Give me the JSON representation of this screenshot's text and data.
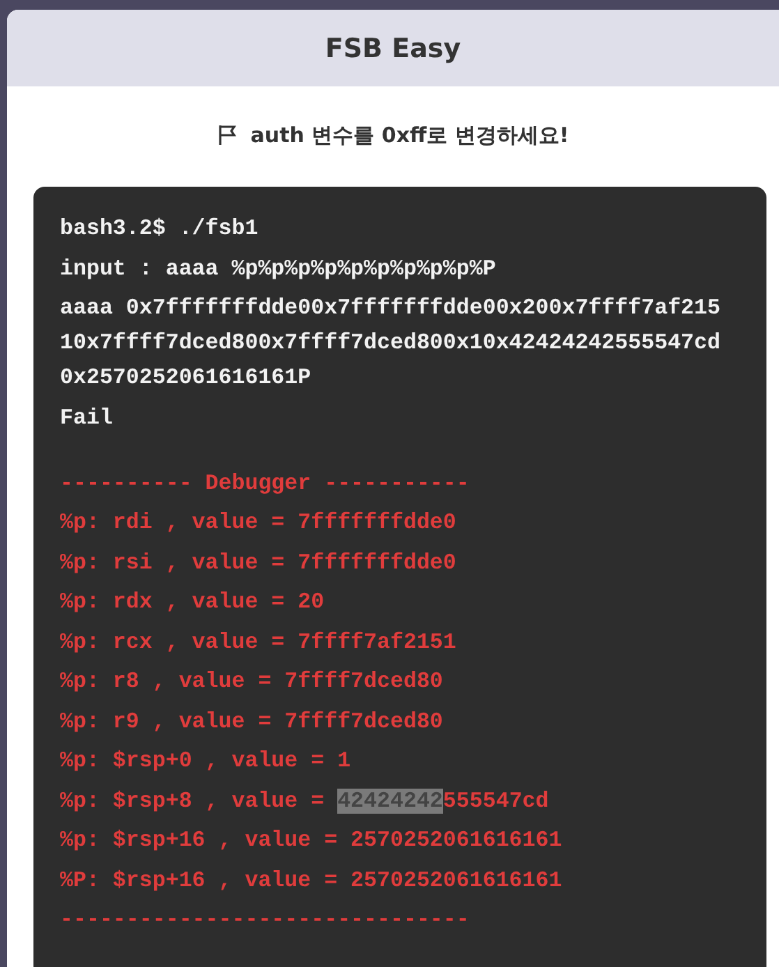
{
  "window": {
    "title": "FSB Easy"
  },
  "task": {
    "text": "auth 변수를 0xff로 변경하세요!"
  },
  "terminal": {
    "lines": [
      {
        "kind": "output",
        "text": "bash3.2$ ./fsb1"
      },
      {
        "kind": "output",
        "text": "input : aaaa %p%p%p%p%p%p%p%p%p%P"
      },
      {
        "kind": "output",
        "text": "aaaa 0x7fffffffdde00x7fffffffdde00x200x7ffff7af21510x7ffff7dced800x7ffff7dced800x10x42424242555547cd0x2570252061616161P"
      },
      {
        "kind": "output",
        "text": "Fail"
      },
      {
        "kind": "debug",
        "text": "---------- Debugger -----------"
      },
      {
        "kind": "debug",
        "text": "%p: rdi , value = 7fffffffdde0"
      },
      {
        "kind": "debug",
        "text": "%p: rsi , value = 7fffffffdde0"
      },
      {
        "kind": "debug",
        "text": "%p: rdx , value = 20"
      },
      {
        "kind": "debug",
        "text": "%p: rcx , value = 7ffff7af2151"
      },
      {
        "kind": "debug",
        "text": "%p: r8 , value = 7ffff7dced80"
      },
      {
        "kind": "debug",
        "text": "%p: r9 , value = 7ffff7dced80"
      },
      {
        "kind": "debug",
        "text": "%p: $rsp+0 , value = 1"
      },
      {
        "kind": "debug",
        "text": "%p: $rsp+8 , value = ",
        "selection": "42424242",
        "after": "555547cd"
      },
      {
        "kind": "debug",
        "text": "%p: $rsp+16 , value = 2570252061616161"
      },
      {
        "kind": "debug",
        "text": "%P: $rsp+16 , value = 2570252061616161"
      },
      {
        "kind": "debug",
        "text": "-------------------------------"
      }
    ]
  }
}
